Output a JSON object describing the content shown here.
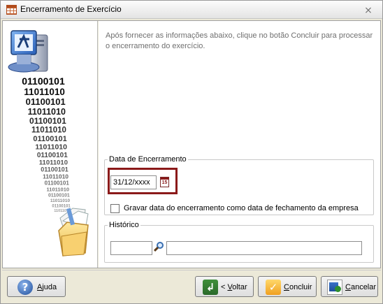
{
  "window": {
    "title": "Encerramento de Exercício",
    "close_glyph": "⨯"
  },
  "intro_text": "Após fornecer as informações abaixo, clique no botão Concluir para processar o encerramento do exercício.",
  "left_panel": {
    "binary_lines": [
      "01100101",
      "11011010",
      "01100101",
      "11011010",
      "01100101",
      "11011010",
      "01100101",
      "11011010",
      "01100101",
      "11011010",
      "01100101",
      "11011010",
      "01100101",
      "11011010",
      "01100101",
      "11011010",
      "01100101",
      "11011010"
    ]
  },
  "date_group": {
    "legend": "Data de Encerramento",
    "date_value": "31/12/xxxx",
    "calendar_icon_text": "15",
    "checkbox_label": "Gravar data do encerramento como data de fechamento da empresa",
    "checkbox_checked": false
  },
  "historico_group": {
    "legend": "Histórico",
    "code_value": "",
    "description_value": ""
  },
  "buttons": {
    "ajuda": {
      "prefix": "",
      "key": "A",
      "rest": "juda"
    },
    "voltar": {
      "prefix": "< ",
      "key": "V",
      "rest": "oltar"
    },
    "concluir": {
      "prefix": "",
      "key": "C",
      "rest": "oncluir"
    },
    "cancelar": {
      "prefix": "",
      "key": "C",
      "rest": "ancelar"
    }
  },
  "colors": {
    "highlight_border": "#8b1a1a",
    "window_bg": "#ece9d8",
    "intro_text": "#6f6f6f"
  }
}
